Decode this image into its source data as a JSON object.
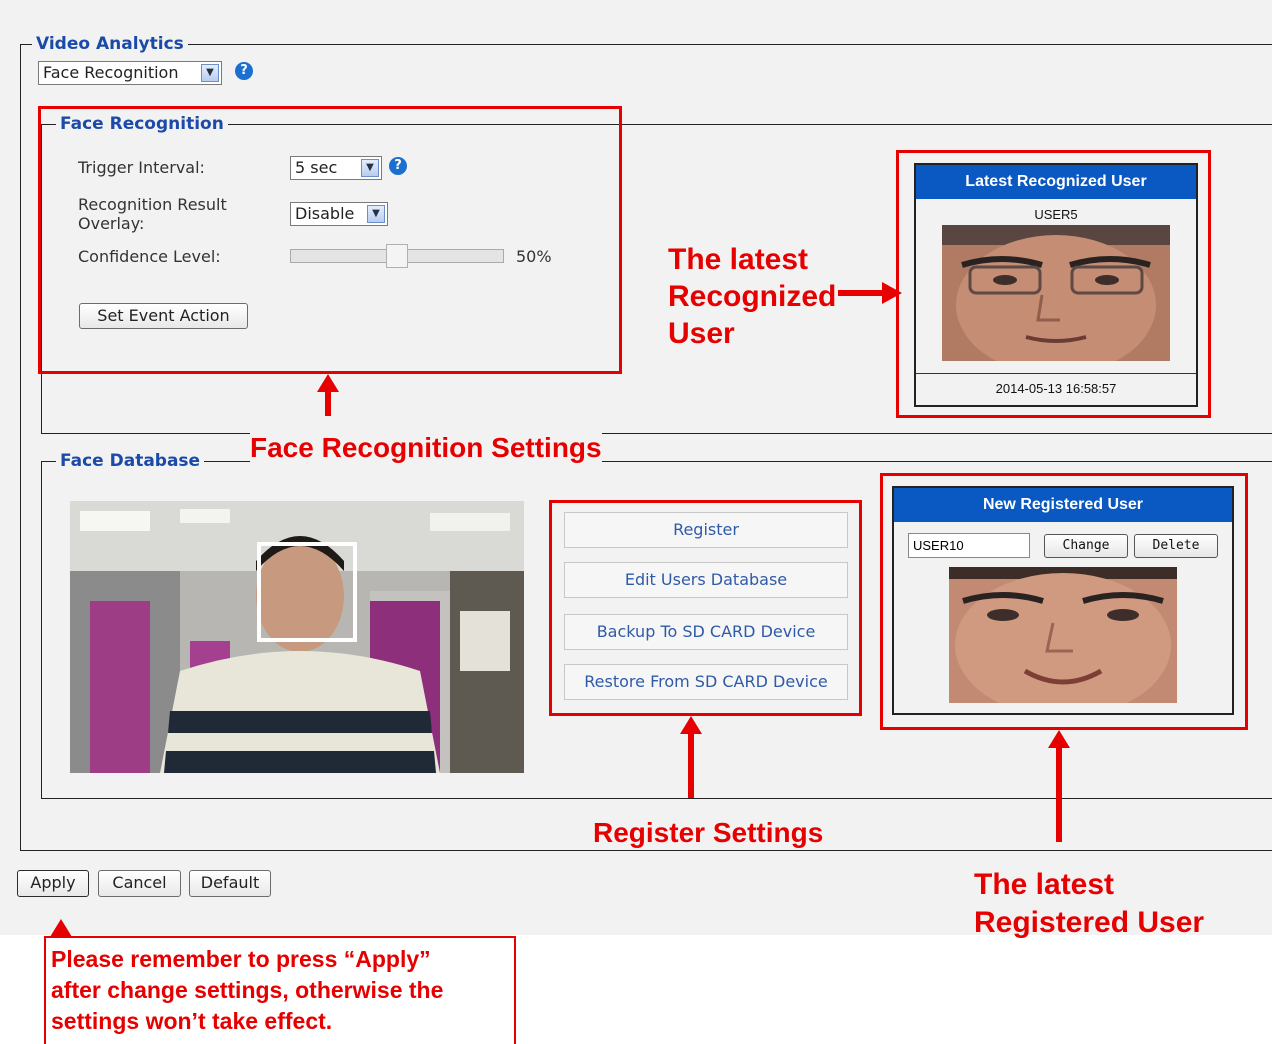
{
  "video_analytics": {
    "legend": "Video Analytics",
    "mode_select": "Face Recognition"
  },
  "face_recognition": {
    "legend": "Face Recognition",
    "trigger_interval_label": "Trigger Interval:",
    "trigger_interval_value": "5 sec",
    "overlay_label_line1": "Recognition Result",
    "overlay_label_line2": "Overlay:",
    "overlay_value": "Disable",
    "confidence_label": "Confidence Level:",
    "confidence_value": "50%",
    "confidence_level": 0.5,
    "set_event_button": "Set Event Action"
  },
  "latest_recognized": {
    "header": "Latest Recognized User",
    "user_name": "USER5",
    "timestamp": "2014-05-13 16:58:57"
  },
  "face_database": {
    "legend": "Face Database",
    "buttons": [
      "Register",
      "Edit Users Database",
      "Backup To SD CARD Device",
      "Restore From SD CARD Device"
    ]
  },
  "new_registered": {
    "header": "New Registered User",
    "user_name_value": "USER10",
    "change_button": "Change",
    "delete_button": "Delete"
  },
  "footer_buttons": {
    "apply": "Apply",
    "cancel": "Cancel",
    "default": "Default"
  },
  "annotations": {
    "latest_recognized_line1": "The latest",
    "latest_recognized_line2": "Recognized",
    "latest_recognized_line3": "User",
    "face_recognition_settings": "Face Recognition Settings",
    "register_settings": "Register Settings",
    "latest_registered_line1": "The latest",
    "latest_registered_line2": "Registered User",
    "apply_note_line1": "Please remember to press “Apply”",
    "apply_note_line2": "after change settings, otherwise the",
    "apply_note_line3": "settings won’t take effect."
  },
  "colors": {
    "annotation_red": "#e60000",
    "header_blue": "#0a58c2",
    "legend_blue": "#1c4aa8"
  }
}
